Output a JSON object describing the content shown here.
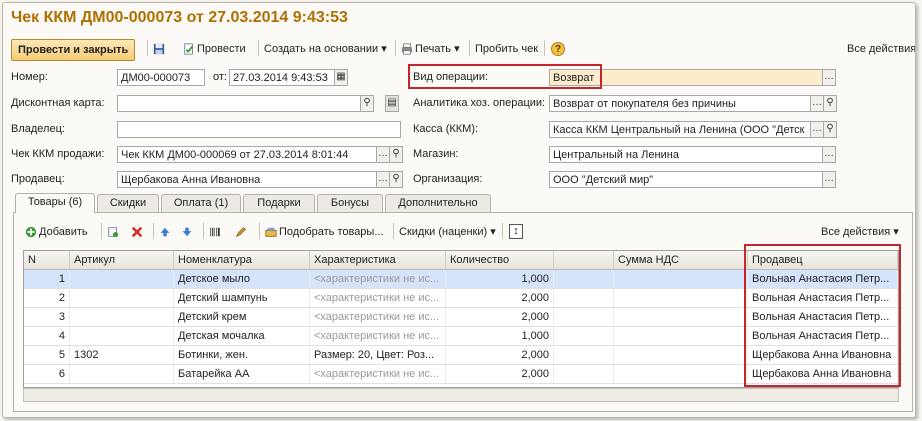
{
  "window": {
    "title": "Чек ККМ ДМ00-000073 от 27.03.2014 9:43:53"
  },
  "toolbar": {
    "post_close": "Провести и закрыть",
    "post": "Провести",
    "create_based": "Создать на основании",
    "print": "Печать",
    "punch_check": "Пробить чек",
    "help": "?",
    "all_actions": "Все действия"
  },
  "form": {
    "number_label": "Номер:",
    "number_value": "ДМ00-000073",
    "date_label": "от:",
    "date_value": "27.03.2014  9:43:53",
    "discount_card_label": "Дисконтная карта:",
    "discount_card_value": "",
    "owner_label": "Владелец:",
    "owner_value": "",
    "sale_check_label": "Чек ККМ продажи:",
    "sale_check_value": "Чек ККМ ДМ00-000069 от 27.03.2014 8:01:44",
    "seller_label": "Продавец:",
    "seller_value": "Щербакова Анна Ивановна",
    "operation_label": "Вид операции:",
    "operation_value": "Возврат",
    "analytics_label": "Аналитика хоз. операции:",
    "analytics_value": "Возврат от покупателя без причины",
    "kassa_label": "Касса (ККМ):",
    "kassa_value": "Касса ККМ Центральный на Ленина (ООО \"Детск",
    "store_label": "Магазин:",
    "store_value": "Центральный на Ленина",
    "org_label": "Организация:",
    "org_value": "ООО \"Детский мир\""
  },
  "tabs": [
    {
      "label": "Товары (6)"
    },
    {
      "label": "Скидки"
    },
    {
      "label": "Оплата (1)"
    },
    {
      "label": "Подарки"
    },
    {
      "label": "Бонусы"
    },
    {
      "label": "Дополнительно"
    }
  ],
  "grid_toolbar": {
    "add": "Добавить",
    "pick_goods": "Подобрать товары...",
    "discounts": "Скидки (наценки)",
    "all_actions": "Все действия"
  },
  "table": {
    "headers": [
      "N",
      "Артикул",
      "Номенклатура",
      "Характеристика",
      "Количество",
      "",
      "Сумма НДС",
      "Продавец"
    ],
    "rows": [
      {
        "n": "1",
        "article": "",
        "item": "Детское мыло",
        "char": "<характеристики не ис...",
        "qty": "1,000",
        "vat": "",
        "seller": "Вольная Анастасия Петр..."
      },
      {
        "n": "2",
        "article": "",
        "item": "Детский шампунь",
        "char": "<характеристики не ис...",
        "qty": "2,000",
        "vat": "",
        "seller": "Вольная Анастасия Петр..."
      },
      {
        "n": "3",
        "article": "",
        "item": "Детский крем",
        "char": "<характеристики не ис...",
        "qty": "2,000",
        "vat": "",
        "seller": "Вольная Анастасия Петр..."
      },
      {
        "n": "4",
        "article": "",
        "item": "Детская мочалка",
        "char": "<характеристики не ис...",
        "qty": "1,000",
        "vat": "",
        "seller": "Вольная Анастасия Петр..."
      },
      {
        "n": "5",
        "article": "1302",
        "item": "Ботинки, жен.",
        "char": "Размер: 20, Цвет: Роз...",
        "qty": "2,000",
        "vat": "",
        "seller": "Щербакова Анна Ивановна"
      },
      {
        "n": "6",
        "article": "",
        "item": "Батарейка АА",
        "char": "<характеристики не ис...",
        "qty": "2,000",
        "vat": "",
        "seller": "Щербакова Анна Ивановна"
      }
    ]
  },
  "colors": {
    "title": "#b06f00",
    "highlight": "#c0282d",
    "selected_row": "#d5e4fa"
  }
}
